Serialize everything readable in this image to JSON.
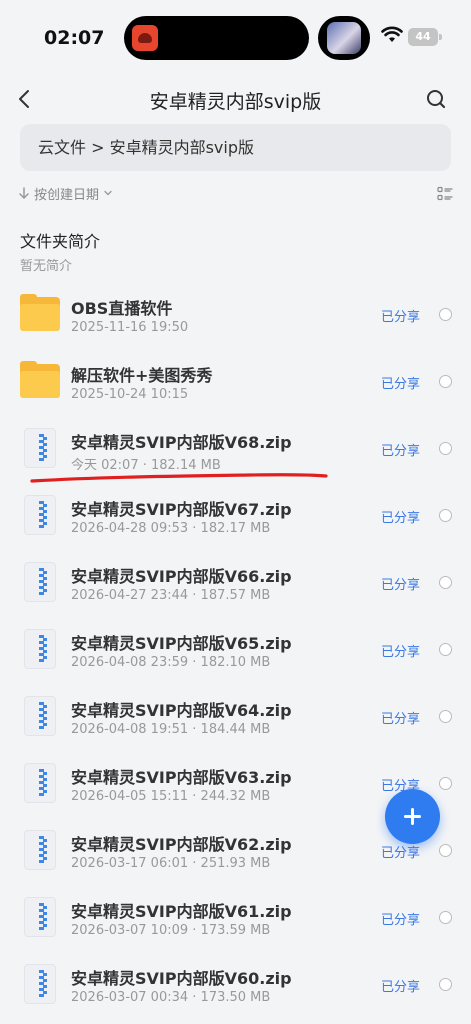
{
  "status_bar": {
    "time": "02:07",
    "battery": "44"
  },
  "nav": {
    "title": "安卓精灵内部svip版"
  },
  "breadcrumb": {
    "text": "云文件 > 安卓精灵内部svip版"
  },
  "sort": {
    "label": "按创建日期"
  },
  "intro": {
    "title": "文件夹简介",
    "empty": "暂无简介"
  },
  "items": [
    {
      "type": "folder",
      "name": "OBS直播软件",
      "meta": "2025-11-16 19:50",
      "status": "已分享"
    },
    {
      "type": "folder",
      "name": "解压软件+美图秀秀",
      "meta": "2025-10-24 10:15",
      "status": "已分享"
    },
    {
      "type": "zip",
      "name": "安卓精灵SVIP内部版V68.zip",
      "meta": "今天 02:07 · 182.14 MB",
      "status": "已分享"
    },
    {
      "type": "zip",
      "name": "安卓精灵SVIP内部版V67.zip",
      "meta": "2026-04-28 09:53 · 182.17 MB",
      "status": "已分享"
    },
    {
      "type": "zip",
      "name": "安卓精灵SVIP内部版V66.zip",
      "meta": "2026-04-27 23:44 · 187.57 MB",
      "status": "已分享"
    },
    {
      "type": "zip",
      "name": "安卓精灵SVIP内部版V65.zip",
      "meta": "2026-04-08 23:59 · 182.10 MB",
      "status": "已分享"
    },
    {
      "type": "zip",
      "name": "安卓精灵SVIP内部版V64.zip",
      "meta": "2026-04-08 19:51 · 184.44 MB",
      "status": "已分享"
    },
    {
      "type": "zip",
      "name": "安卓精灵SVIP内部版V63.zip",
      "meta": "2026-04-05 15:11 · 244.32 MB",
      "status": "已分享"
    },
    {
      "type": "zip",
      "name": "安卓精灵SVIP内部版V62.zip",
      "meta": "2026-03-17 06:01 · 251.93 MB",
      "status": "已分享"
    },
    {
      "type": "zip",
      "name": "安卓精灵SVIP内部版V61.zip",
      "meta": "2026-03-07 10:09 · 173.59 MB",
      "status": "已分享"
    },
    {
      "type": "zip",
      "name": "安卓精灵SVIP内部版V60.zip",
      "meta": "2026-03-07 00:34 · 173.50 MB",
      "status": "已分享"
    }
  ],
  "colors": {
    "accent": "#3a78e6",
    "fab": "#2f7bf0",
    "folder": "#f7b738",
    "annotation": "#e02020"
  }
}
